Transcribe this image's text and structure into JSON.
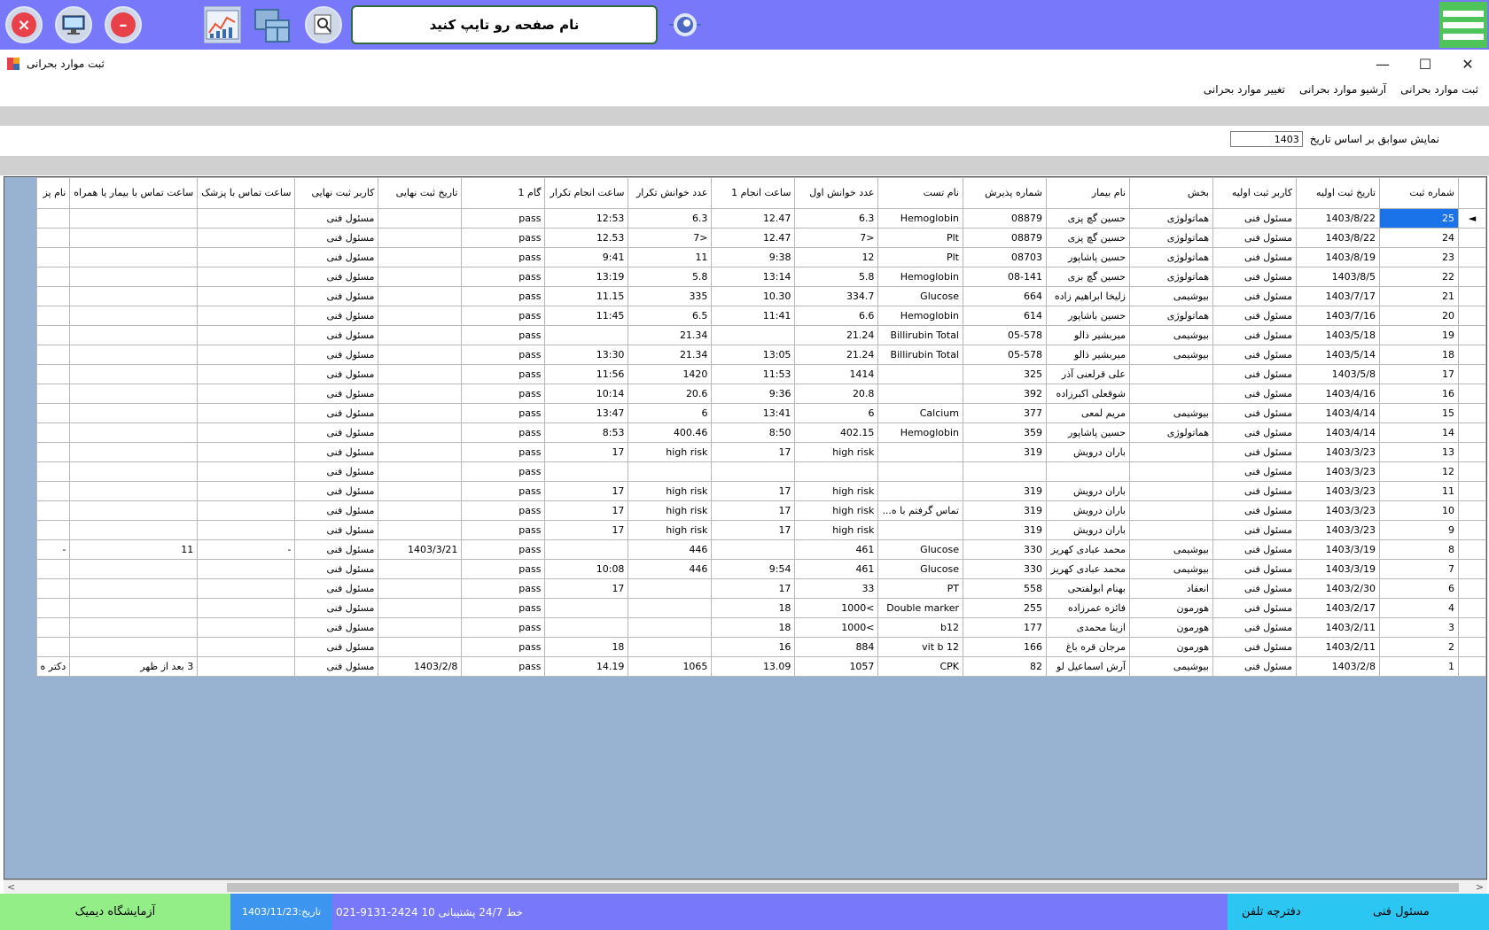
{
  "toolbar": {
    "search_placeholder": "نام صفحه رو تایپ کنید",
    "icons": [
      "close-circle-icon",
      "monitor-icon",
      "minus-circle-icon",
      "chart-icon",
      "windows-icon",
      "zoom-icon",
      "toggle-icon",
      "menu-icon"
    ]
  },
  "window": {
    "title": "ثبت موارد بحرانی"
  },
  "tabs": [
    "ثبت موارد بحرانی",
    "آرشیو موارد بحرانی",
    "تغییر موارد بحرانی"
  ],
  "filter": {
    "label": "نمایش سوابق بر اساس تاریخ",
    "value": "1403"
  },
  "grid": {
    "columns": [
      "شماره ثبت",
      "تاریخ ثبت اولیه",
      "کاربر ثبت اولیه",
      "بخش",
      "نام بیمار",
      "شماره پذیرش",
      "نام تست",
      "عدد خوانش اول",
      "ساعت انجام 1",
      "عدد خوانش تکرار",
      "ساعت انجام تکرار",
      "گام 1",
      "تاریخ ثبت نهایی",
      "کاربر ثبت نهایی",
      "ساعت تماس با پزشک",
      "ساعت تماس با بیمار یا همراه",
      "نام پز"
    ],
    "rows": [
      [
        "25",
        "1403/8/22",
        "مسئول فنی",
        "هماتولوژی",
        "حسین گچ پزی",
        "08879",
        "Hemoglobin",
        "6.3",
        "12.47",
        "6.3",
        "12:53",
        "pass",
        "",
        "مسئول فنی",
        "",
        "",
        ""
      ],
      [
        "24",
        "1403/8/22",
        "مسئول فنی",
        "هماتولوژی",
        "حسین گچ پزی",
        "08879",
        "Plt",
        "7>",
        "12.47",
        "7>",
        "12.53",
        "pass",
        "",
        "مسئول فنی",
        "",
        "",
        ""
      ],
      [
        "23",
        "1403/8/19",
        "مسئول فنی",
        "هماتولوژی",
        "حسین پاشاپور",
        "08703",
        "Plt",
        "12",
        "9:38",
        "11",
        "9:41",
        "pass",
        "",
        "مسئول فنی",
        "",
        "",
        ""
      ],
      [
        "22",
        "1403/8/5",
        "مسئول فنی",
        "هماتولوژی",
        "حسین گچ بزی",
        "08-141",
        "Hemoglobin",
        "5.8",
        "13:14",
        "5.8",
        "13:19",
        "pass",
        "",
        "مسئول فنی",
        "",
        "",
        ""
      ],
      [
        "21",
        "1403/7/17",
        "مسئول فنی",
        "بیوشیمی",
        "زلیخا ابراهیم زاده",
        "664",
        "Glucose",
        "334.7",
        "10.30",
        "335",
        "11.15",
        "pass",
        "",
        "مسئول فنی",
        "",
        "",
        ""
      ],
      [
        "20",
        "1403/7/16",
        "مسئول فنی",
        "هماتولوژی",
        "حسین باشاپور",
        "614",
        "Hemoglobin",
        "6.6",
        "11:41",
        "6.5",
        "11:45",
        "pass",
        "",
        "مسئول فنی",
        "",
        "",
        ""
      ],
      [
        "19",
        "1403/5/18",
        "مسئول فنی",
        "بیوشیمی",
        "میربشیر ذالو",
        "05-578",
        "Billirubin Total",
        "21.24",
        "",
        "21.34",
        "",
        "pass",
        "",
        "مسئول فنی",
        "",
        "",
        ""
      ],
      [
        "18",
        "1403/5/14",
        "مسئول فنی",
        "بیوشیمی",
        "میربشیر ذالو",
        "05-578",
        "Billirubin Total",
        "21.24",
        "13:05",
        "21.34",
        "13:30",
        "pass",
        "",
        "مسئول فنی",
        "",
        "",
        ""
      ],
      [
        "17",
        "1403/5/8",
        "مسئول فنی",
        "",
        "علی قرلعنی آذر",
        "325",
        "",
        "1414",
        "11:53",
        "1420",
        "11:56",
        "pass",
        "",
        "مسئول فنی",
        "",
        "",
        ""
      ],
      [
        "16",
        "1403/4/16",
        "مسئول فنی",
        "",
        "شوقعلی اکبرزاده",
        "392",
        "",
        "20.8",
        "9:36",
        "20.6",
        "10:14",
        "pass",
        "",
        "مسئول فنی",
        "",
        "",
        ""
      ],
      [
        "15",
        "1403/4/14",
        "مسئول فنی",
        "بیوشیمی",
        "مریم لمعی",
        "377",
        "Calcium",
        "6",
        "13:41",
        "6",
        "13:47",
        "pass",
        "",
        "مسئول فنی",
        "",
        "",
        ""
      ],
      [
        "14",
        "1403/4/14",
        "مسئول فنی",
        "هماتولوژی",
        "حسین پاشاپور",
        "359",
        "Hemoglobin",
        "402.15",
        "8:50",
        "400.46",
        "8:53",
        "pass",
        "",
        "مسئول فنی",
        "",
        "",
        ""
      ],
      [
        "13",
        "1403/3/23",
        "مسئول فنی",
        "",
        "باران  درویش",
        "319",
        "",
        "high risk",
        "17",
        "high risk",
        "17",
        "pass",
        "",
        "مسئول فنی",
        "",
        "",
        ""
      ],
      [
        "12",
        "1403/3/23",
        "مسئول فنی",
        "",
        "",
        "",
        "",
        "",
        "",
        "",
        "",
        "pass",
        "",
        "مسئول فنی",
        "",
        "",
        ""
      ],
      [
        "11",
        "1403/3/23",
        "مسئول فنی",
        "",
        "باران  درویش",
        "319",
        "",
        "high risk",
        "17",
        "high risk",
        "17",
        "pass",
        "",
        "مسئول فنی",
        "",
        "",
        ""
      ],
      [
        "10",
        "1403/3/23",
        "مسئول فنی",
        "",
        "باران  درویش",
        "319",
        "تماس گرفتم با ه...",
        "high risk",
        "17",
        "high risk",
        "17",
        "pass",
        "",
        "مسئول فنی",
        "",
        "",
        ""
      ],
      [
        "9",
        "1403/3/23",
        "مسئول فنی",
        "",
        "باران  درویش",
        "319",
        "",
        "high risk",
        "17",
        "high risk",
        "17",
        "pass",
        "",
        "مسئول فنی",
        "",
        "",
        ""
      ],
      [
        "8",
        "1403/3/19",
        "مسئول فنی",
        "بیوشیمی",
        "محمد عبادی کهریز",
        "330",
        "Glucose",
        "461",
        "",
        "446",
        "",
        "pass",
        "1403/3/21",
        "مسئول فنی",
        "-",
        "11",
        "-"
      ],
      [
        "7",
        "1403/3/19",
        "مسئول فنی",
        "بیوشیمی",
        "محمد عبادی کهریز",
        "330",
        "Glucose",
        "461",
        "9:54",
        "446",
        "10:08",
        "pass",
        "",
        "مسئول فنی",
        "",
        "",
        ""
      ],
      [
        "6",
        "1403/2/30",
        "مسئول فنی",
        "انعقاد",
        "بهنام ابولفتحی",
        "558",
        "PT",
        "33",
        "17",
        "",
        "17",
        "pass",
        "",
        "مسئول فنی",
        "",
        "",
        ""
      ],
      [
        "4",
        "1403/2/17",
        "مسئول فنی",
        "هورمون",
        "فائزه عمرزاده",
        "255",
        "Double marker",
        "1000<",
        "18",
        "",
        "",
        "pass",
        "",
        "مسئول فنی",
        "",
        "",
        ""
      ],
      [
        "3",
        "1403/2/11",
        "مسئول فنی",
        "هورمون",
        "ازینا محمدی",
        "177",
        "b12",
        "1000<",
        "18",
        "",
        "",
        "pass",
        "",
        "مسئول فنی",
        "",
        "",
        ""
      ],
      [
        "2",
        "1403/2/11",
        "مسئول فنی",
        "هورمون",
        "مرجان قره باغ",
        "166",
        "vit b 12",
        "884",
        "16",
        "",
        "18",
        "pass",
        "",
        "مسئول فنی",
        "",
        "",
        ""
      ],
      [
        "1",
        "1403/2/8",
        "مسئول فنی",
        "بیوشیمی",
        "آرش اسماعیل لو",
        "82",
        "CPK",
        "1057",
        "13.09",
        "1065",
        "14.19",
        "pass",
        "1403/2/8",
        "مسئول فنی",
        "",
        "3 بعد از ظهر",
        "دکتر ه"
      ]
    ]
  },
  "status": {
    "lab_name": "آزمایشگاه دیمیک",
    "date": "تاریخ:1403/11/23",
    "support": "021-9131-2424  10 خط   24/7  پشتیبانی",
    "phonebook": "دفترچه تلفن",
    "user": "مسئول فنی"
  }
}
